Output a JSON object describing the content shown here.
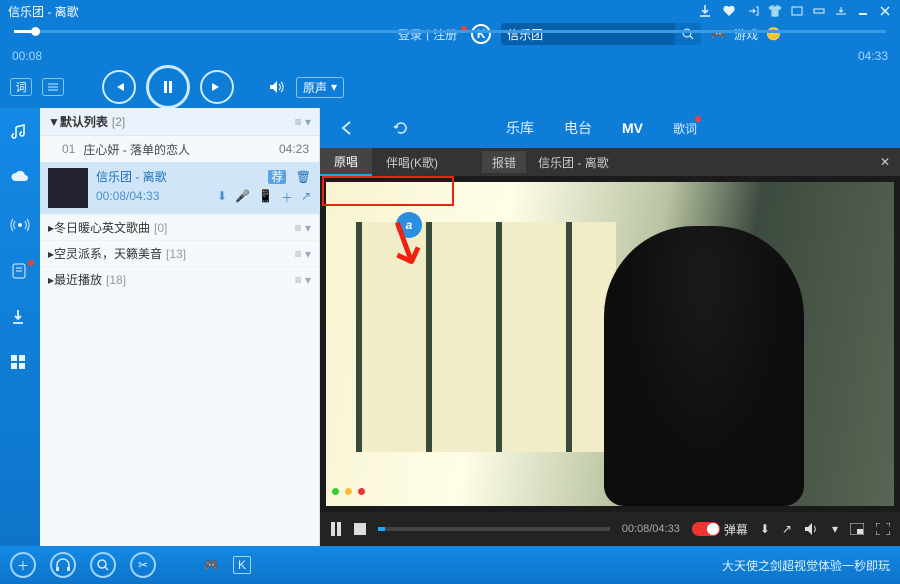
{
  "title": "信乐团 - 离歌",
  "progress": {
    "current": "00:08",
    "total": "04:33"
  },
  "player": {
    "lyric_btn": "词",
    "source_label": "原声"
  },
  "login": {
    "login": "登录",
    "register": "注册"
  },
  "search": {
    "value": "信乐团"
  },
  "games": {
    "label": "游戏"
  },
  "nav": {
    "tabs": [
      "乐库",
      "电台",
      "MV",
      "歌词"
    ],
    "active": 2
  },
  "playlist": {
    "header": "默认列表",
    "header_count": "[2]",
    "rows": [
      {
        "idx": "01",
        "title": "庄心妍 - 落单的恋人",
        "dur": "04:23"
      }
    ],
    "now": {
      "title": "信乐团 - 离歌",
      "time": "00:08/04:33",
      "badge": "荐"
    },
    "groups": [
      {
        "name": "冬日暖心英文歌曲",
        "count": "[0]"
      },
      {
        "name": "空灵派系，天籁美音",
        "count": "[13]"
      },
      {
        "name": "最近播放",
        "count": "[18]"
      }
    ]
  },
  "video": {
    "segs": [
      "原唱",
      "伴唱(K歌)"
    ],
    "seg_active": 0,
    "report": "报错",
    "title": "信乐团 - 离歌",
    "time": "00:08/04:33",
    "danmu": "弹幕",
    "logo": "a"
  },
  "bottom": {
    "promo": "大天使之剑超视觉体验一秒即玩"
  }
}
